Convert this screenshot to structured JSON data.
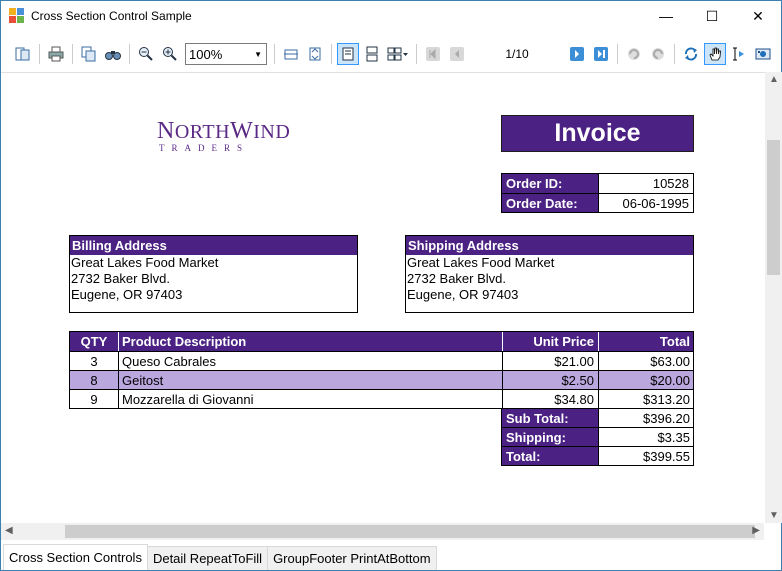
{
  "window": {
    "title": "Cross Section Control Sample",
    "controls": {
      "minimize": "—",
      "maximize": "☐",
      "close": "✕"
    }
  },
  "toolbar": {
    "zoom_value": "100%",
    "page_indicator": "1/10",
    "icons": [
      "table-of-contents-icon",
      "print-icon",
      "copy-icon",
      "find-icon",
      "zoom-out-icon",
      "zoom-in-icon",
      "page-width-icon",
      "whole-page-icon",
      "single-page-icon",
      "continuous-page-icon",
      "multipage-icon",
      "first-page-icon",
      "previous-page-icon",
      "next-page-icon",
      "last-page-icon",
      "back-icon",
      "forward-icon",
      "refresh-icon",
      "pan-hand-icon",
      "selection-icon",
      "snapshot-icon"
    ]
  },
  "report": {
    "logo": {
      "line1_cap1": "N",
      "line1_rest1": "ORTH",
      "line1_cap2": "W",
      "line1_rest2": "IND",
      "line2": "TRADERS"
    },
    "title": "Invoice",
    "meta": [
      {
        "label": "Order ID:",
        "value": "10528"
      },
      {
        "label": "Order Date:",
        "value": "06-06-1995"
      }
    ],
    "billing": {
      "heading": "Billing Address",
      "lines": [
        "Great Lakes Food Market",
        "2732 Baker Blvd.",
        "Eugene, OR  97403"
      ]
    },
    "shipping": {
      "heading": "Shipping Address",
      "lines": [
        "Great Lakes Food Market",
        "2732 Baker Blvd.",
        "Eugene, OR  97403"
      ]
    },
    "items_header": {
      "qty": "QTY",
      "desc": "Product Description",
      "unit": "Unit Price",
      "total": "Total"
    },
    "items": [
      {
        "qty": "3",
        "desc": "Queso Cabrales",
        "unit": "$21.00",
        "total": "$63.00"
      },
      {
        "qty": "8",
        "desc": "Geitost",
        "unit": "$2.50",
        "total": "$20.00"
      },
      {
        "qty": "9",
        "desc": "Mozzarella di Giovanni",
        "unit": "$34.80",
        "total": "$313.20"
      }
    ],
    "totals": [
      {
        "label": "Sub Total:",
        "value": "$396.20"
      },
      {
        "label": "Shipping:",
        "value": "$3.35"
      },
      {
        "label": "Total:",
        "value": "$399.55"
      }
    ]
  },
  "tabs": [
    {
      "label": "Cross Section Controls",
      "active": true
    },
    {
      "label": "Detail RepeatToFill",
      "active": false
    },
    {
      "label": "GroupFooter PrintAtBottom",
      "active": false
    }
  ],
  "colors": {
    "header_purple": "#4b2283",
    "alt_row_lavender": "#b9a7dd",
    "logo_purple": "#5b2a86"
  }
}
